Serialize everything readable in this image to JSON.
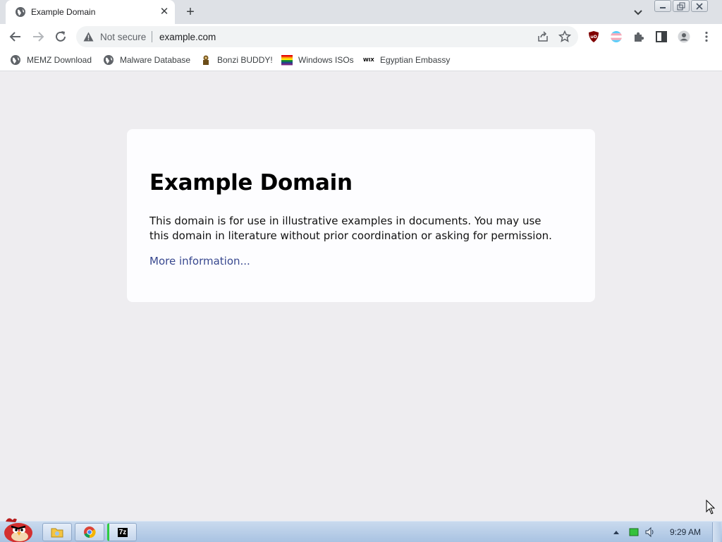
{
  "browser": {
    "tab": {
      "title": "Example Domain",
      "close": "✕"
    },
    "new_tab": "+",
    "omnibox": {
      "security_label": "Not secure",
      "url": "example.com"
    }
  },
  "bookmarks": [
    {
      "label": "MEMZ Download",
      "icon": "globe-icon"
    },
    {
      "label": "Malware Database",
      "icon": "globe-icon"
    },
    {
      "label": "Bonzi BUDDY!",
      "icon": "bonzi-icon"
    },
    {
      "label": "Windows ISOs",
      "icon": "rainbow-flag-icon"
    },
    {
      "label": "Egyptian Embassy",
      "icon": "wix-icon",
      "icon_text": "WIX"
    }
  ],
  "page": {
    "heading": "Example Domain",
    "body": "This domain is for use in illustrative examples in documents. You may use this domain in literature without prior coordination or asking for permission.",
    "link": "More information..."
  },
  "taskbar": {
    "clock": "9:29 AM",
    "buttons": [
      {
        "name": "explorer-icon"
      },
      {
        "name": "chrome-icon"
      },
      {
        "name": "7zip-icon",
        "label": "7z"
      }
    ]
  },
  "colors": {
    "page_bg": "#eeedf0",
    "card_bg": "#fdfdff",
    "link": "#38488f",
    "tabstrip": "#dee1e6"
  }
}
